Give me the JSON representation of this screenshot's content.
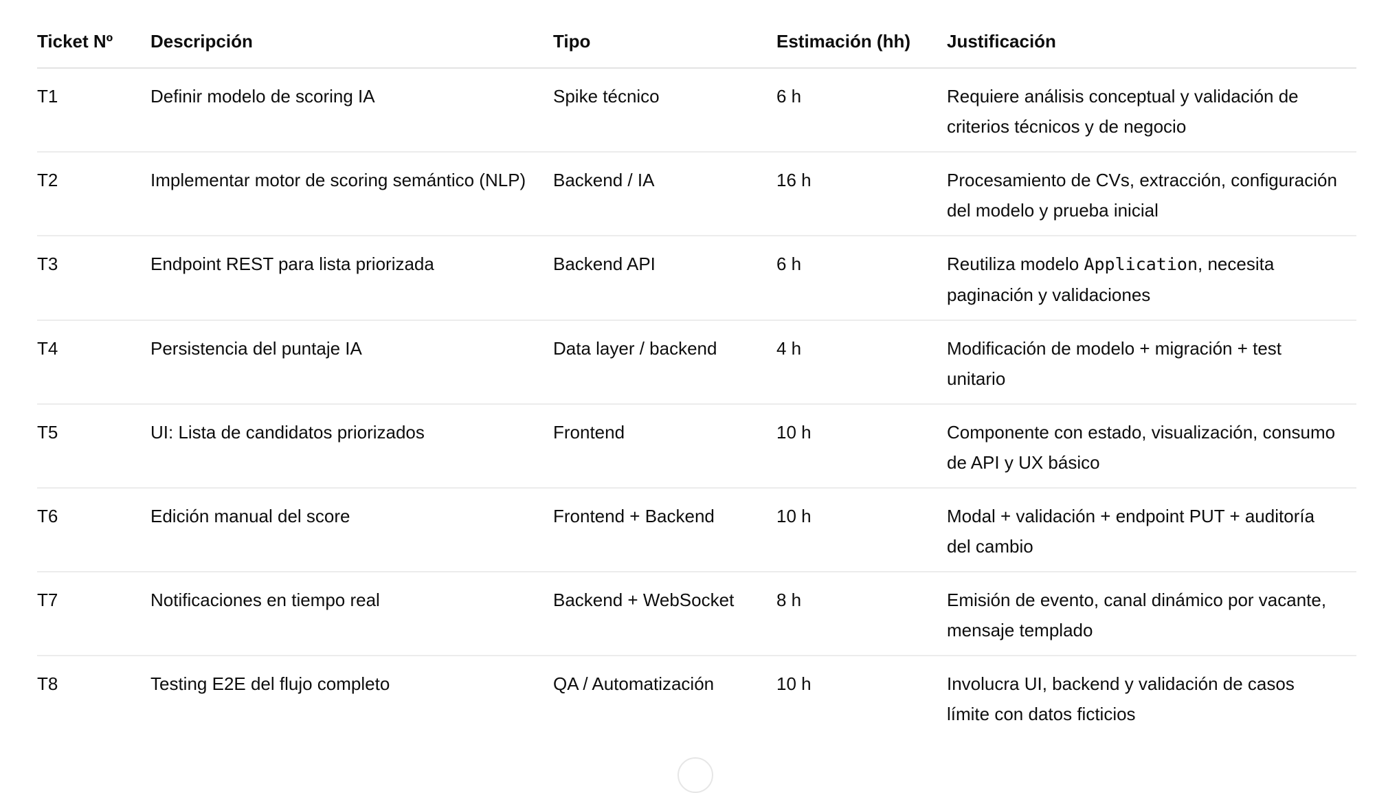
{
  "table": {
    "headers": [
      "Ticket Nº",
      "Descripción",
      "Tipo",
      "Estimación (hh)",
      "Justificación"
    ],
    "rows": [
      {
        "ticket": "T1",
        "description": "Definir modelo de scoring IA",
        "type": "Spike técnico",
        "estimate": "6 h",
        "justification": [
          "Requiere análisis conceptual y validación de criterios técnicos y de negocio"
        ]
      },
      {
        "ticket": "T2",
        "description": "Implementar motor de scoring semántico (NLP)",
        "type": "Backend / IA",
        "estimate": "16 h",
        "justification": [
          "Procesamiento de CVs, extracción, configuración del modelo y prueba inicial"
        ]
      },
      {
        "ticket": "T3",
        "description": "Endpoint REST para lista priorizada",
        "type": "Backend API",
        "estimate": "6 h",
        "justification": [
          "Reutiliza modelo ",
          "Application",
          ", necesita paginación y validaciones"
        ]
      },
      {
        "ticket": "T4",
        "description": "Persistencia del puntaje IA",
        "type": "Data layer / backend",
        "estimate": "4 h",
        "justification": [
          "Modificación de modelo + migración + test unitario"
        ]
      },
      {
        "ticket": "T5",
        "description": "UI: Lista de candidatos priorizados",
        "type": "Frontend",
        "estimate": "10 h",
        "justification": [
          "Componente con estado, visualización, consumo de API y UX básico"
        ]
      },
      {
        "ticket": "T6",
        "description": "Edición manual del score",
        "type": "Frontend + Backend",
        "estimate": "10 h",
        "justification": [
          "Modal + validación + endpoint PUT + auditoría del cambio"
        ]
      },
      {
        "ticket": "T7",
        "description": "Notificaciones en tiempo real",
        "type": "Backend + WebSocket",
        "estimate": "8 h",
        "justification": [
          "Emisión de evento, canal dinámico por vacante, mensaje templado"
        ]
      },
      {
        "ticket": "T8",
        "description": "Testing E2E del flujo completo",
        "type": "QA / Automatización",
        "estimate": "10 h",
        "justification": [
          "Involucra UI, backend y validación de casos límite con datos ficticios"
        ]
      }
    ]
  }
}
